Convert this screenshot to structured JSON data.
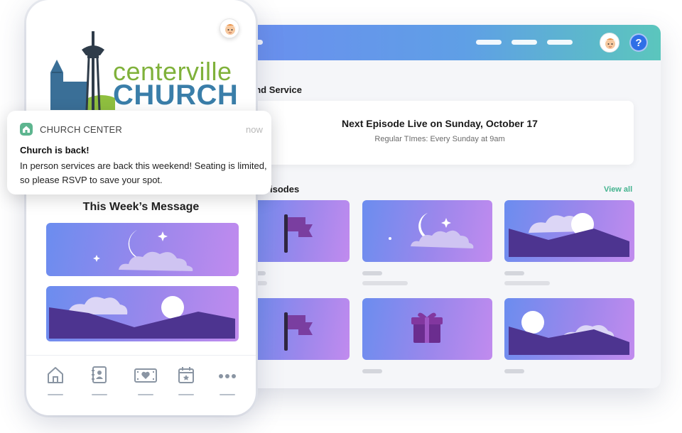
{
  "desktop": {
    "header": {
      "help_label": "?",
      "avatar_icon": "user-avatar-icon"
    },
    "service_section_title": "end Service",
    "live_card": {
      "title": "Next Episode Live on Sunday, October 17",
      "subtitle": "Regular TImes: Every Sunday at 9am"
    },
    "episodes_section_title": "isodes",
    "view_all_label": "View all",
    "episode_thumbnails": [
      {
        "icon": "flag-icon"
      },
      {
        "icon": "moon-clouds-icon"
      },
      {
        "icon": "mountains-sun-icon"
      },
      {
        "icon": "flag-icon"
      },
      {
        "icon": "gift-icon"
      },
      {
        "icon": "mountains-sun-icon"
      }
    ]
  },
  "phone": {
    "logo": {
      "word1": "centerville",
      "word2": "CHURCH"
    },
    "message_title": "This Week’s Message",
    "message_thumbnails": [
      {
        "icon": "moon-clouds-icon"
      },
      {
        "icon": "mountains-sun-icon"
      }
    ],
    "bottom_nav": [
      {
        "icon": "home-icon"
      },
      {
        "icon": "directory-icon"
      },
      {
        "icon": "giving-icon"
      },
      {
        "icon": "calendar-icon"
      },
      {
        "icon": "more-icon"
      }
    ]
  },
  "notification": {
    "app_name": "CHURCH CENTER",
    "time": "now",
    "title": "Church is back!",
    "body": "In person services are back this weekend! Seating is limited, so please RSVP to save your spot."
  },
  "colors": {
    "header_gradient_start": "#6c8df0",
    "header_gradient_end": "#5bc6bd",
    "help_blue": "#2f6fe7",
    "thumb_purple": "#9b87ec",
    "logo_green": "#7fb13a",
    "logo_blue": "#3a7ea9",
    "view_all_green": "#44b38f"
  }
}
